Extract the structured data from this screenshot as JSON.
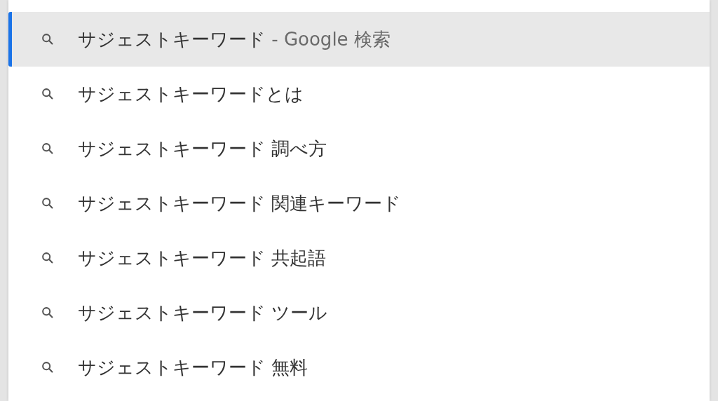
{
  "suggestions": [
    {
      "text": "サジェストキーワード",
      "suffix": " - Google 検索",
      "selected": true
    },
    {
      "text": "サジェストキーワードとは",
      "selected": false
    },
    {
      "text": "サジェストキーワード 調べ方",
      "selected": false
    },
    {
      "text": "サジェストキーワード 関連キーワード",
      "selected": false
    },
    {
      "text": "サジェストキーワード 共起語",
      "selected": false
    },
    {
      "text": "サジェストキーワード ツール",
      "selected": false
    },
    {
      "text": "サジェストキーワード 無料",
      "selected": false
    }
  ]
}
